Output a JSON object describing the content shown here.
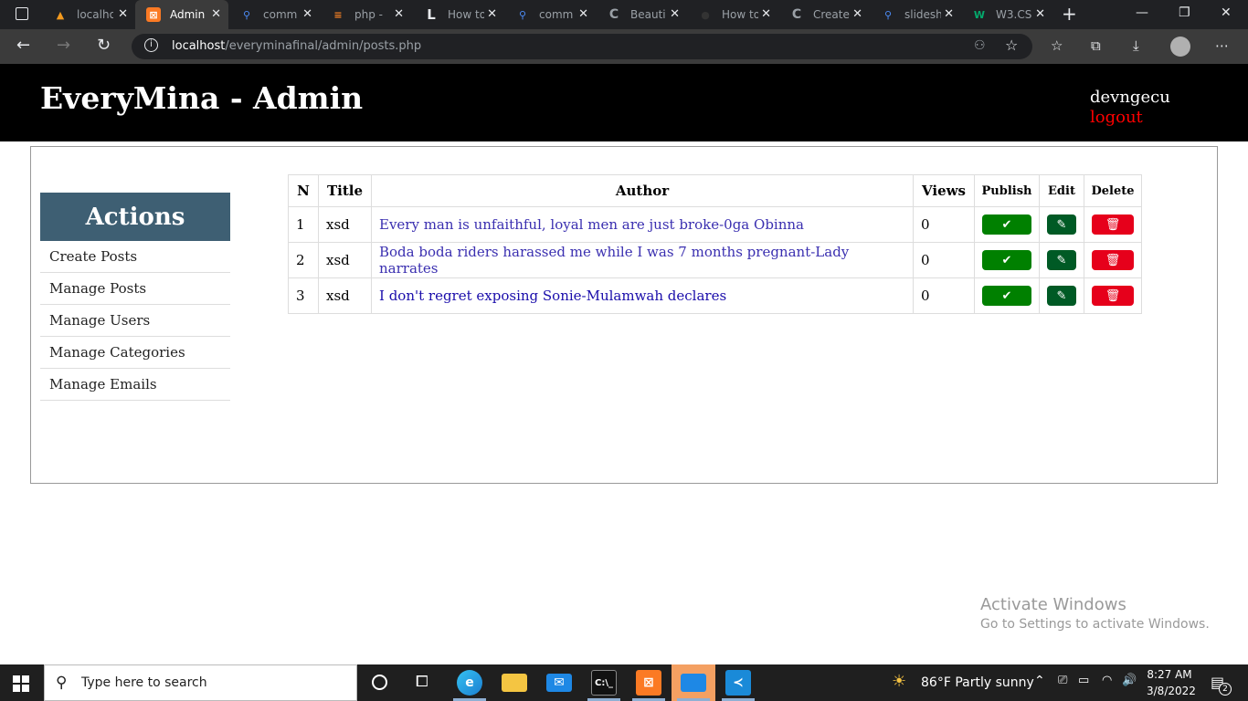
{
  "browser": {
    "tabs": [
      {
        "label": "localhost",
        "icon": "xampp-favicon",
        "active": false
      },
      {
        "label": "Admin",
        "icon": "xampp-icon",
        "active": true
      },
      {
        "label": "comm",
        "icon": "search-icon",
        "active": false
      },
      {
        "label": "php - ",
        "icon": "stackoverflow-icon",
        "active": false
      },
      {
        "label": "How to",
        "icon": "l-icon",
        "active": false
      },
      {
        "label": "comm",
        "icon": "search-icon",
        "active": false
      },
      {
        "label": "Beauti",
        "icon": "c-icon",
        "active": false
      },
      {
        "label": "How to",
        "icon": "github-icon",
        "active": false
      },
      {
        "label": "Create",
        "icon": "c-icon",
        "active": false
      },
      {
        "label": "slidesh",
        "icon": "search-icon",
        "active": false
      },
      {
        "label": "W3.CS",
        "icon": "w3-icon",
        "active": false
      }
    ],
    "url_host": "localhost",
    "url_path": "/everyminafinal/admin/posts.php"
  },
  "header": {
    "title": "EveryMina - Admin",
    "username": "devngecu",
    "logout": "logout"
  },
  "sidebar": {
    "heading": "Actions",
    "items": [
      {
        "label": "Create Posts"
      },
      {
        "label": "Manage Posts"
      },
      {
        "label": "Manage Users"
      },
      {
        "label": "Manage Categories"
      },
      {
        "label": "Manage Emails"
      }
    ]
  },
  "table": {
    "headers": {
      "n": "N",
      "title": "Title",
      "author": "Author",
      "views": "Views",
      "publish": "Publish",
      "edit": "Edit",
      "delete": "Delete"
    },
    "rows": [
      {
        "n": "1",
        "title": "xsd",
        "author": "Every man is unfaithful, loyal men are just broke-0ga Obinna",
        "views": "0"
      },
      {
        "n": "2",
        "title": "xsd",
        "author": "Boda boda riders harassed me while I was 7 months pregnant-Lady narrates",
        "views": "0"
      },
      {
        "n": "3",
        "title": "xsd",
        "author": "I don't regret exposing Sonie-Mulamwah declares",
        "views": "0"
      }
    ]
  },
  "watermark": {
    "line1": "Activate Windows",
    "line2": "Go to Settings to activate Windows."
  },
  "taskbar": {
    "search_placeholder": "Type here to search",
    "weather": "86°F  Partly sunny",
    "time": "8:27 AM",
    "date": "3/8/2022",
    "notification_count": "2"
  },
  "colors": {
    "header_bg": "#000000",
    "actions_bg": "#3e5f73",
    "publish_btn": "#008000",
    "edit_btn": "#005a25",
    "delete_btn": "#e6001b",
    "logout_text": "#ff0000"
  }
}
